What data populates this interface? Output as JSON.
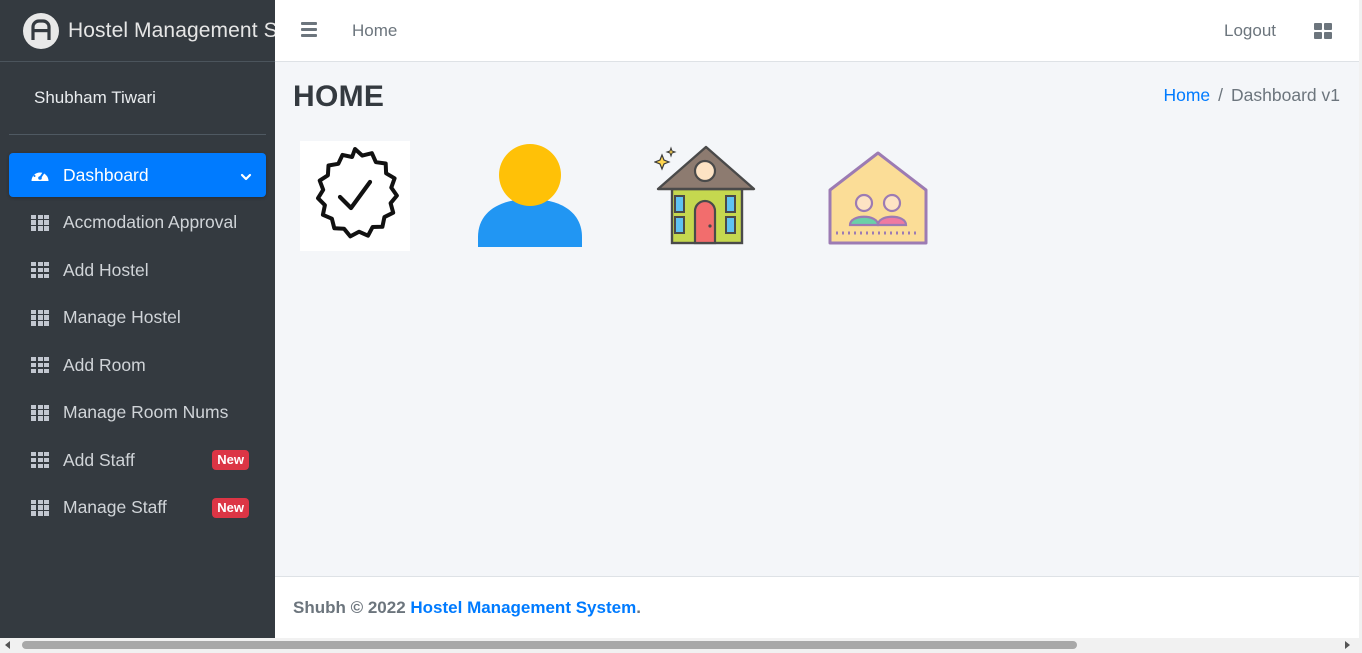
{
  "brand": {
    "title": "Hostel Management System"
  },
  "user": {
    "name": "Shubham Tiwari"
  },
  "sidebar": {
    "items": [
      {
        "label": "Dashboard",
        "icon": "tachometer-icon",
        "active": true
      },
      {
        "label": "Accmodation Approval",
        "icon": "grid-icon"
      },
      {
        "label": "Add Hostel",
        "icon": "grid-icon"
      },
      {
        "label": "Manage Hostel",
        "icon": "grid-icon"
      },
      {
        "label": "Add Room",
        "icon": "grid-icon"
      },
      {
        "label": "Manage Room Nums",
        "icon": "grid-icon"
      },
      {
        "label": "Add Staff",
        "icon": "grid-icon",
        "badge": "New"
      },
      {
        "label": "Manage Staff",
        "icon": "grid-icon",
        "badge": "New"
      }
    ]
  },
  "header": {
    "home_label": "Home",
    "logout_label": "Logout"
  },
  "content": {
    "title": "HOME",
    "breadcrumb": {
      "home": "Home",
      "separator": "/",
      "current": "Dashboard v1"
    },
    "tiles": [
      {
        "icon": "verified-badge-icon"
      },
      {
        "icon": "user-icon"
      },
      {
        "icon": "hostel-house-icon"
      },
      {
        "icon": "room-occupants-icon"
      }
    ]
  },
  "footer": {
    "prefix": "Shubh © 2022 ",
    "link": "Hostel Management System",
    "suffix": "."
  },
  "colors": {
    "sidebar_bg": "#343a40",
    "accent": "#007bff",
    "badge": "#dc3545",
    "content_bg": "#f4f6f9"
  }
}
